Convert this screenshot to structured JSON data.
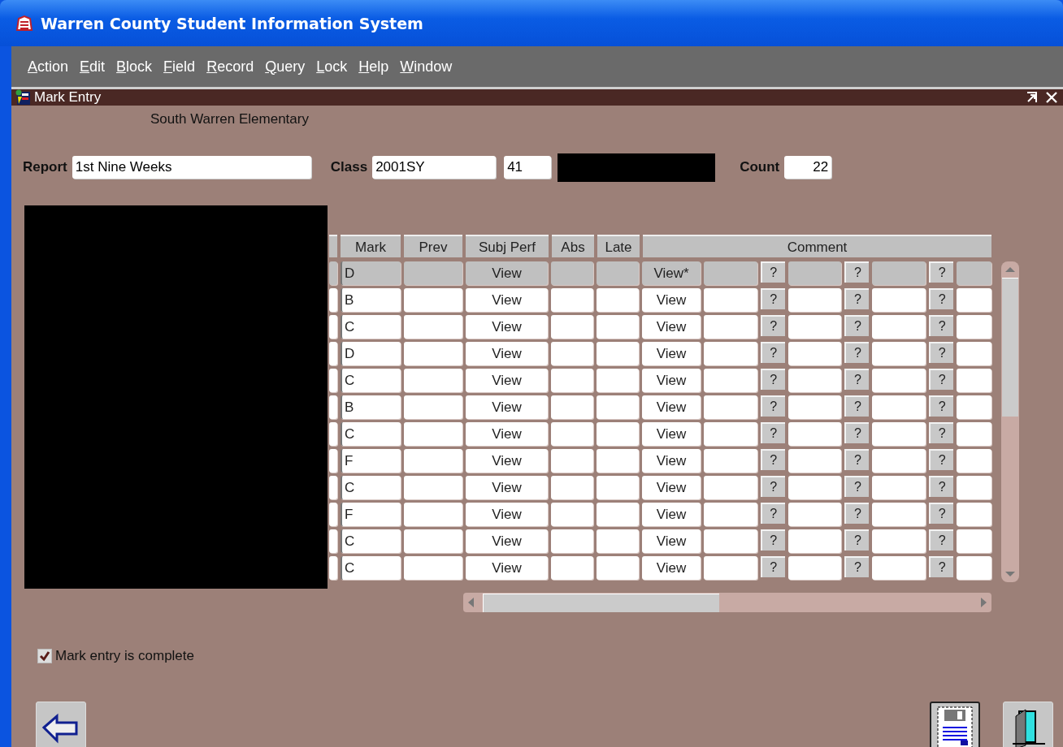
{
  "window": {
    "title": "Warren County Student Information System"
  },
  "menu": [
    {
      "label": "Action"
    },
    {
      "label": "Edit"
    },
    {
      "label": "Block"
    },
    {
      "label": "Field"
    },
    {
      "label": "Record"
    },
    {
      "label": "Query"
    },
    {
      "label": "Lock"
    },
    {
      "label": "Help"
    },
    {
      "label": "Window"
    }
  ],
  "form": {
    "title": "Mark Entry",
    "school": "South Warren Elementary",
    "report_label": "Report",
    "report": "1st Nine Weeks",
    "class_label": "Class",
    "class": "2001SY",
    "section": "41",
    "count_label": "Count",
    "count": "22"
  },
  "table": {
    "columns": [
      "Mark",
      "Prev",
      "Subj Perf",
      "Abs",
      "Late",
      "Comment"
    ],
    "rows": [
      {
        "selected": true,
        "mark": "D",
        "subj_perf": "View",
        "comment": "View*",
        "help": [
          "?",
          "?",
          "?"
        ]
      },
      {
        "selected": false,
        "mark": "B",
        "subj_perf": "View",
        "comment": "View",
        "help": [
          "?",
          "?",
          "?"
        ]
      },
      {
        "selected": false,
        "mark": "C",
        "subj_perf": "View",
        "comment": "View",
        "help": [
          "?",
          "?",
          "?"
        ]
      },
      {
        "selected": false,
        "mark": "D",
        "subj_perf": "View",
        "comment": "View",
        "help": [
          "?",
          "?",
          "?"
        ]
      },
      {
        "selected": false,
        "mark": "C",
        "subj_perf": "View",
        "comment": "View",
        "help": [
          "?",
          "?",
          "?"
        ]
      },
      {
        "selected": false,
        "mark": "B",
        "subj_perf": "View",
        "comment": "View",
        "help": [
          "?",
          "?",
          "?"
        ]
      },
      {
        "selected": false,
        "mark": "C",
        "subj_perf": "View",
        "comment": "View",
        "help": [
          "?",
          "?",
          "?"
        ]
      },
      {
        "selected": false,
        "mark": "F",
        "subj_perf": "View",
        "comment": "View",
        "help": [
          "?",
          "?",
          "?"
        ]
      },
      {
        "selected": false,
        "mark": "C",
        "subj_perf": "View",
        "comment": "View",
        "help": [
          "?",
          "?",
          "?"
        ]
      },
      {
        "selected": false,
        "mark": "F",
        "subj_perf": "View",
        "comment": "View",
        "help": [
          "?",
          "?",
          "?"
        ]
      },
      {
        "selected": false,
        "mark": "C",
        "subj_perf": "View",
        "comment": "View",
        "help": [
          "?",
          "?",
          "?"
        ]
      },
      {
        "selected": false,
        "mark": "C",
        "subj_perf": "View",
        "comment": "View",
        "help": [
          "?",
          "?",
          "?"
        ]
      }
    ]
  },
  "complete": {
    "label": "Mark entry is complete",
    "checked": true
  }
}
